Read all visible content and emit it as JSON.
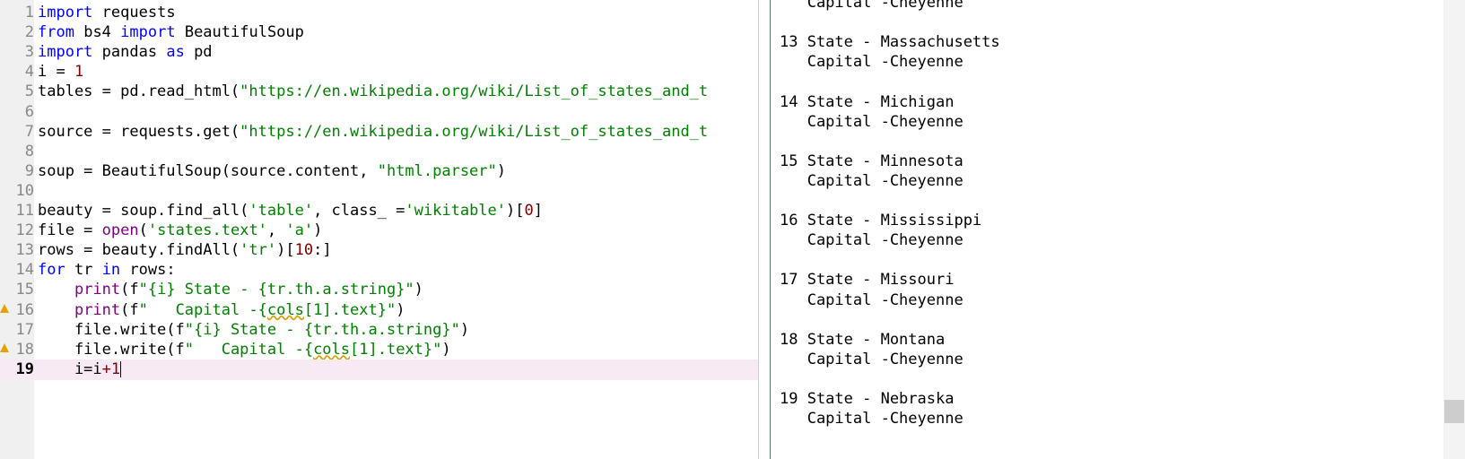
{
  "editor": {
    "lines": [
      {
        "n": "1",
        "segs": [
          [
            "kw",
            "import"
          ],
          [
            "",
            "requests"
          ]
        ]
      },
      {
        "n": "2",
        "segs": [
          [
            "kw",
            "from"
          ],
          [
            "",
            "bs4 "
          ],
          [
            "kw",
            "import"
          ],
          [
            "",
            "BeautifulSoup"
          ]
        ]
      },
      {
        "n": "3",
        "segs": [
          [
            "kw",
            "import"
          ],
          [
            "",
            "pandas "
          ],
          [
            "kw",
            "as"
          ],
          [
            "",
            "pd"
          ]
        ]
      },
      {
        "n": "4",
        "segs": [
          [
            "",
            "i = "
          ],
          [
            "nm",
            "1"
          ]
        ]
      },
      {
        "n": "5",
        "segs": [
          [
            "",
            "tables = pd.read_html("
          ],
          [
            "st",
            "\"https://en.wikipedia.org/wiki/List_of_states_and_t"
          ]
        ]
      },
      {
        "n": "6",
        "segs": []
      },
      {
        "n": "7",
        "segs": [
          [
            "",
            "source = requests.get("
          ],
          [
            "st",
            "\"https://en.wikipedia.org/wiki/List_of_states_and_t"
          ]
        ]
      },
      {
        "n": "8",
        "segs": []
      },
      {
        "n": "9",
        "segs": [
          [
            "",
            "soup = BeautifulSoup(source.content, "
          ],
          [
            "st",
            "\"html.parser\""
          ],
          [
            "",
            ")"
          ]
        ]
      },
      {
        "n": "10",
        "segs": []
      },
      {
        "n": "11",
        "segs": [
          [
            "",
            "beauty = soup.find_all("
          ],
          [
            "st",
            "'table'"
          ],
          [
            "",
            ", class_ ="
          ],
          [
            "st",
            "'wikitable'"
          ],
          [
            "",
            ")["
          ],
          [
            "nm",
            "0"
          ],
          [
            "",
            "]"
          ]
        ]
      },
      {
        "n": "12",
        "segs": [
          [
            "",
            "file = "
          ],
          [
            "bi",
            "open"
          ],
          [
            "",
            "("
          ],
          [
            "st",
            "'states.text'"
          ],
          [
            "",
            ", "
          ],
          [
            "st",
            "'a'"
          ],
          [
            "",
            ")"
          ]
        ]
      },
      {
        "n": "13",
        "segs": [
          [
            "",
            "rows = beauty.findAll("
          ],
          [
            "st",
            "'tr'"
          ],
          [
            "",
            ")["
          ],
          [
            "nm",
            "10"
          ],
          [
            "",
            ":]"
          ]
        ]
      },
      {
        "n": "14",
        "segs": [
          [
            "kw",
            "for"
          ],
          [
            "",
            "tr "
          ],
          [
            "kw",
            "in"
          ],
          [
            "",
            "rows:"
          ]
        ]
      },
      {
        "n": "15",
        "segs": [
          [
            "",
            "    "
          ],
          [
            "bi",
            "print"
          ],
          [
            "",
            "(f"
          ],
          [
            "st",
            "\"{i} State - {tr.th.a.string}\""
          ],
          [
            "",
            ")"
          ]
        ]
      },
      {
        "n": "16",
        "warn": true,
        "segs": [
          [
            "",
            "    "
          ],
          [
            "bi",
            "print"
          ],
          [
            "",
            "(f"
          ],
          [
            "st",
            "\"   Capital -{"
          ],
          [
            "st err",
            "cols"
          ],
          [
            "st",
            "[1].text}\""
          ],
          [
            "",
            ")"
          ]
        ]
      },
      {
        "n": "17",
        "segs": [
          [
            "",
            "    file.write(f"
          ],
          [
            "st",
            "\"{i} State - {tr.th.a.string}\""
          ],
          [
            "",
            ")"
          ]
        ]
      },
      {
        "n": "18",
        "warn": true,
        "segs": [
          [
            "",
            "    file.write(f"
          ],
          [
            "st",
            "\"   Capital -{"
          ],
          [
            "st err",
            "cols"
          ],
          [
            "st",
            "[1].text}\""
          ],
          [
            "",
            ")"
          ]
        ]
      },
      {
        "n": "19",
        "current": true,
        "segs": [
          [
            "",
            "    i=i"
          ],
          [
            "nm",
            "+1"
          ]
        ]
      }
    ]
  },
  "output": {
    "lines": [
      "   Capital -Cheyenne",
      "",
      "13 State - Massachusetts",
      "   Capital -Cheyenne",
      "",
      "14 State - Michigan",
      "   Capital -Cheyenne",
      "",
      "15 State - Minnesota",
      "   Capital -Cheyenne",
      "",
      "16 State - Mississippi",
      "   Capital -Cheyenne",
      "",
      "17 State - Missouri",
      "   Capital -Cheyenne",
      "",
      "18 State - Montana",
      "   Capital -Cheyenne",
      "",
      "19 State - Nebraska",
      "   Capital -Cheyenne"
    ]
  }
}
